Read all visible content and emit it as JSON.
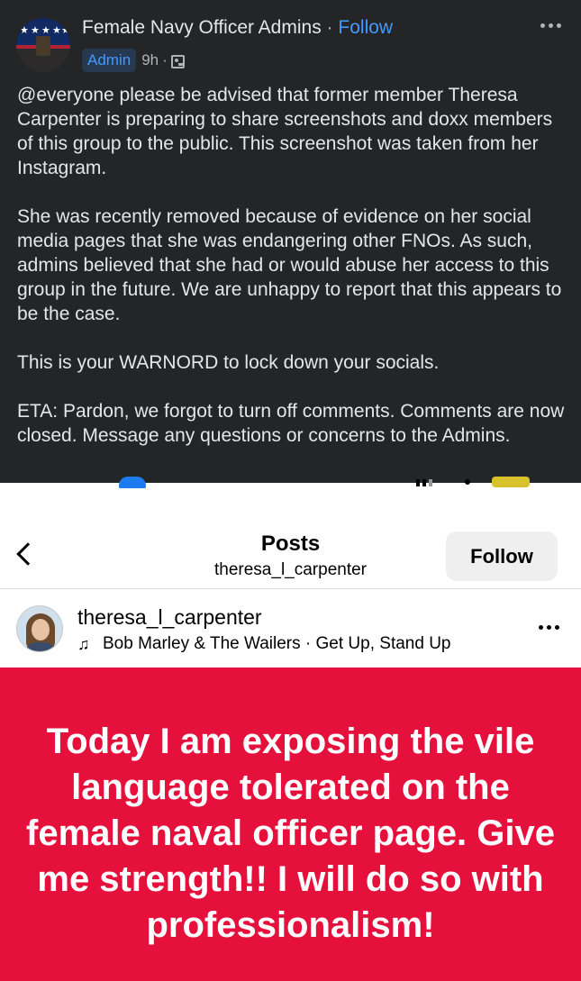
{
  "facebook": {
    "group_name": "Female Navy Officer Admins",
    "separator": "·",
    "follow_label": "Follow",
    "admin_badge": "Admin",
    "time": "9h",
    "time_separator": "·",
    "body": [
      "@everyone please be advised that former member Theresa Carpenter is preparing to share screenshots and doxx members of this group to the public. This screenshot was taken from her Instagram.",
      "She was recently removed because of evidence on her social media pages that she was endangering other FNOs. As such, admins believed that she had or would abuse her access to this group in the future. We are unhappy to report that this appears to be the case.",
      "This is your WARNORD to lock down your socials.",
      "ETA: Pardon, we forgot to turn off comments. Comments are now closed. Message any questions or concerns to the Admins."
    ],
    "icons": {
      "audience": "group-audience-icon",
      "more": "more-options-icon"
    }
  },
  "instagram": {
    "title": "Posts",
    "subtitle": "theresa_l_carpenter",
    "follow_label": "Follow",
    "post": {
      "username": "theresa_l_carpenter",
      "audio": "Bob Marley & The Wailers · Get Up, Stand Up",
      "image_text": "Today I am exposing the vile language tolerated on the female naval officer page. Give me strength!! I will do so with professionalism!"
    },
    "colors": {
      "image_background": "#e5103c",
      "follow_button": "#efefef"
    }
  },
  "colors": {
    "fb_background": "#242526",
    "fb_link": "#4599ff"
  }
}
